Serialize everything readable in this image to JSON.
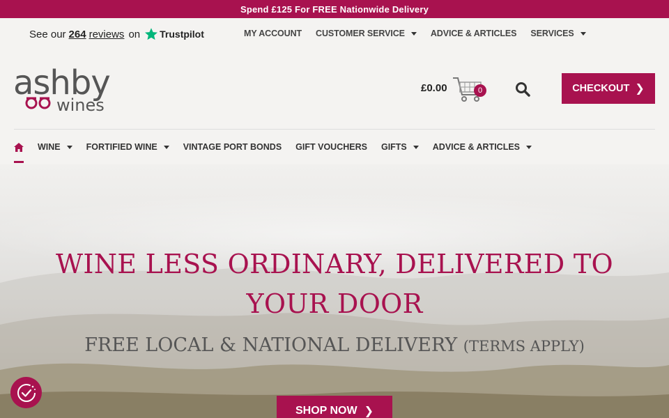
{
  "promo": {
    "text": "Spend £125 For FREE Nationwide Delivery"
  },
  "trustpilot": {
    "prefix": "See our",
    "count": "264",
    "reviews": "reviews",
    "on": "on",
    "brand": "Trustpilot"
  },
  "util_nav": [
    {
      "label": "MY ACCOUNT",
      "dropdown": false
    },
    {
      "label": "CUSTOMER SERVICE",
      "dropdown": true
    },
    {
      "label": "ADVICE & ARTICLES",
      "dropdown": false
    },
    {
      "label": "SERVICES",
      "dropdown": true
    }
  ],
  "logo": {
    "line1": "ashby",
    "line2": "wines"
  },
  "cart": {
    "total": "£0.00",
    "count": "0"
  },
  "checkout": {
    "label": "CHECKOUT"
  },
  "main_nav": [
    {
      "label": "WINE",
      "dropdown": true
    },
    {
      "label": "FORTIFIED WINE",
      "dropdown": true
    },
    {
      "label": "VINTAGE PORT BONDS",
      "dropdown": false
    },
    {
      "label": "GIFT VOUCHERS",
      "dropdown": false
    },
    {
      "label": "GIFTS",
      "dropdown": true
    },
    {
      "label": "ADVICE & ARTICLES",
      "dropdown": true
    }
  ],
  "hero": {
    "title": "WINE LESS ORDINARY, DELIVERED TO YOUR DOOR",
    "subtitle": "FREE LOCAL & NATIONAL DELIVERY",
    "terms": "(TERMS APPLY)",
    "button": "SHOP NOW"
  },
  "colors": {
    "brand": "#a8124f",
    "background": "#f4f3f1"
  },
  "icons": {
    "home": "home-icon",
    "cart": "shopping-cart-icon",
    "search": "search-icon",
    "cookie": "cookie-consent-icon",
    "trustpilot": "trustpilot-star-icon"
  }
}
